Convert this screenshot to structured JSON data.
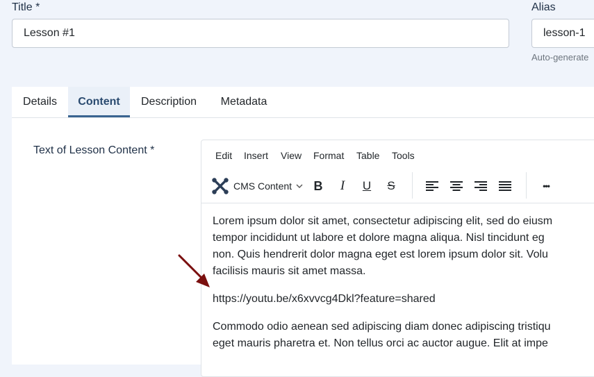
{
  "form": {
    "title_label": "Title *",
    "title_value": "Lesson #1",
    "alias_label": "Alias",
    "alias_value": "lesson-1",
    "alias_hint": "Auto-generate"
  },
  "tabs": [
    {
      "label": "Details",
      "active": false
    },
    {
      "label": "Content",
      "active": true
    },
    {
      "label": "Description",
      "active": false
    },
    {
      "label": "Metadata",
      "active": false
    }
  ],
  "content": {
    "field_label": "Text of Lesson Content *"
  },
  "editor": {
    "menu": [
      "Edit",
      "Insert",
      "View",
      "Format",
      "Table",
      "Tools"
    ],
    "cms_content_label": "CMS Content",
    "toolbar_icons": {
      "bold": "B",
      "italic": "I",
      "underline": "U",
      "strike": "S",
      "more": "•••"
    },
    "paragraphs": [
      {
        "lines": [
          "Lorem ipsum dolor sit amet, consectetur adipiscing elit, sed do eiusm",
          "tempor incididunt ut labore et dolore magna aliqua. Nisl tincidunt eg",
          "non. Quis hendrerit dolor magna eget est lorem ipsum dolor sit. Volu",
          "facilisis mauris sit amet massa."
        ]
      },
      {
        "lines": [
          "https://youtu.be/x6xvvcg4Dkl?feature=shared"
        ]
      },
      {
        "lines": [
          "Commodo odio aenean sed adipiscing diam donec adipiscing tristiqu",
          "eget mauris pharetra et. Non tellus orci ac auctor augue. Elit at impe"
        ]
      }
    ]
  },
  "colors": {
    "accent": "#3a6491",
    "arrow": "#7a0f0f",
    "page_bg": "#f0f4fb"
  }
}
